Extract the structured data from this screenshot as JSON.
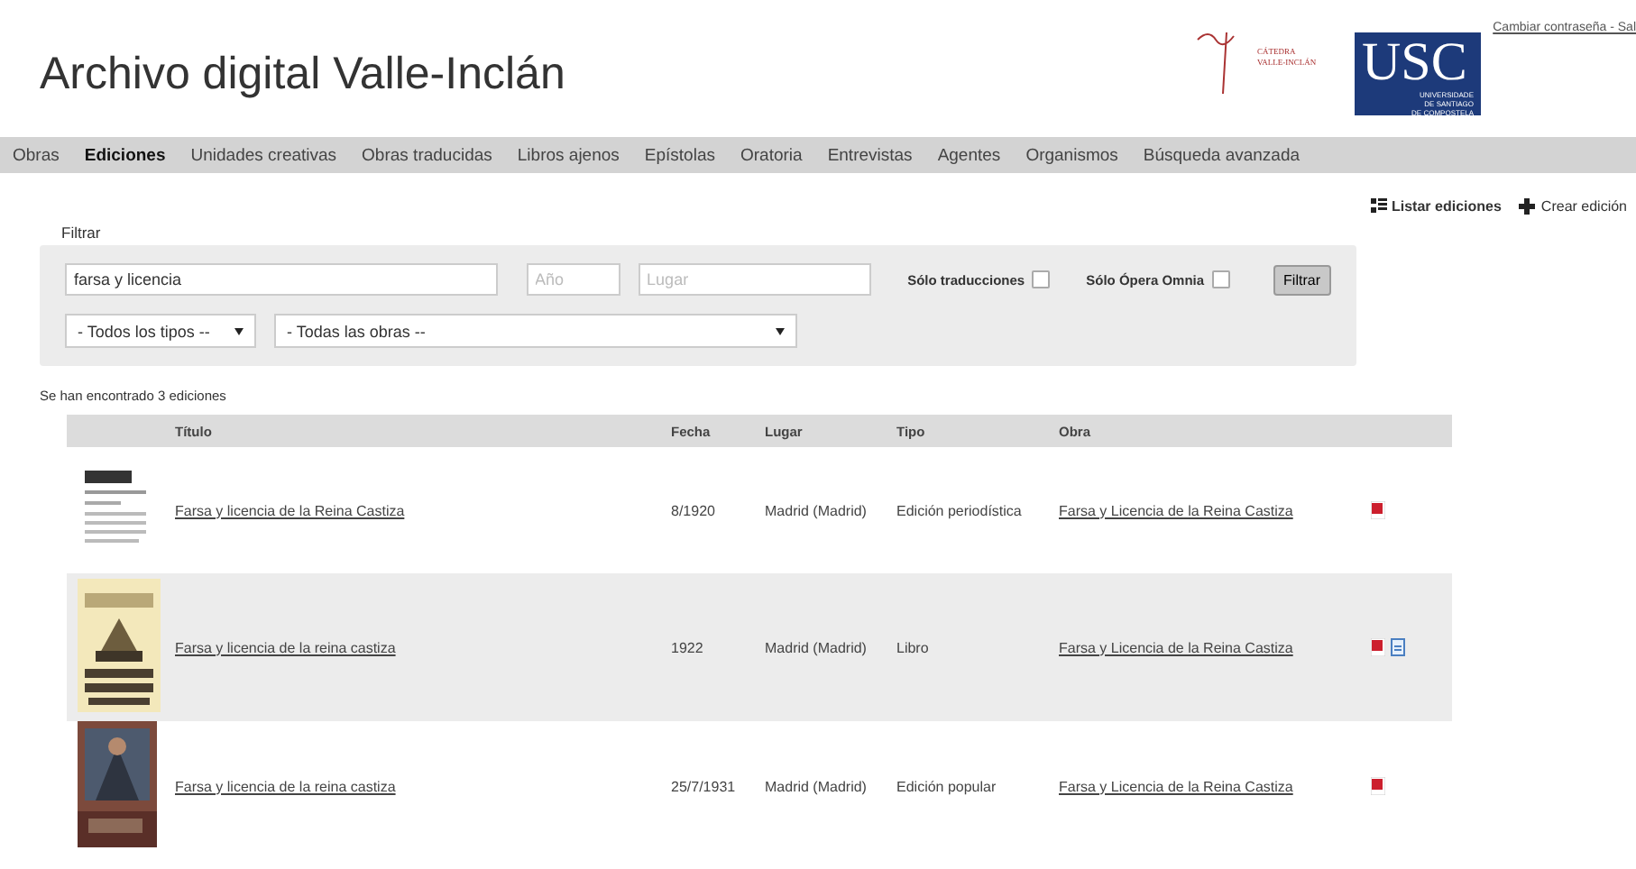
{
  "header": {
    "title": "Archivo digital Valle-Inclán",
    "catedra_logo": {
      "line1": "CÁTEDRA",
      "line2": "VALLE-INCLÁN"
    },
    "usc_logo": {
      "mark": "USC",
      "lines": [
        "UNIVERSIDADE",
        "DE SANTIAGO",
        "DE COMPOSTELA"
      ]
    },
    "user_links": "Cambiar contraseña - Sal"
  },
  "nav": [
    {
      "label": "Obras",
      "selected": false
    },
    {
      "label": "Ediciones",
      "selected": true
    },
    {
      "label": "Unidades creativas",
      "selected": false
    },
    {
      "label": "Obras traducidas",
      "selected": false
    },
    {
      "label": "Libros ajenos",
      "selected": false
    },
    {
      "label": "Epístolas",
      "selected": false
    },
    {
      "label": "Oratoria",
      "selected": false
    },
    {
      "label": "Entrevistas",
      "selected": false
    },
    {
      "label": "Agentes",
      "selected": false
    },
    {
      "label": "Organismos",
      "selected": false
    },
    {
      "label": "Búsqueda avanzada",
      "selected": false
    }
  ],
  "actions": [
    {
      "kind": "list",
      "label": "Listar ediciones"
    },
    {
      "kind": "create",
      "label": "Crear edición"
    }
  ],
  "filter": {
    "legend": "Filtrar",
    "search": {
      "value": "farsa y licencia"
    },
    "year": {
      "placeholder": "Año"
    },
    "place": {
      "placeholder": "Lugar"
    },
    "checks": [
      {
        "label": "Sólo traducciones",
        "checked": false
      },
      {
        "label": "Sólo Ópera Omnia",
        "checked": false
      }
    ],
    "button": "Filtrar",
    "type_select": "- Todos los tipos --",
    "work_select": "- Todas las obras --"
  },
  "result_count": "Se han encontrado 3 ediciones",
  "table": {
    "columns": [
      "Título",
      "Fecha",
      "Lugar",
      "Tipo",
      "Obra"
    ],
    "rows": [
      {
        "thumb": {
          "kind": "picture"
        },
        "title": "Farsa y licencia de la Reina Castiza",
        "date": "8/1920",
        "place": "Madrid (Madrid)",
        "type": "Edición periodística",
        "work": "Farsa y Licencia de la Reina Castiza",
        "files": [
          {
            "kind": "pdf"
          }
        ]
      },
      {
        "thumb": {
          "kind": "picture"
        },
        "title": "Farsa y licencia de la reina castiza",
        "date": "1922",
        "place": "Madrid (Madrid)",
        "type": "Libro",
        "work": "Farsa y Licencia de la Reina Castiza",
        "files": [
          {
            "kind": "pdf"
          },
          {
            "kind": "doc"
          }
        ]
      },
      {
        "thumb": {
          "kind": "picture"
        },
        "title": "Farsa y licencia de la reina castiza",
        "date": "25/7/1931",
        "place": "Madrid (Madrid)",
        "type": "Edición popular",
        "work": "Farsa y Licencia de la Reina Castiza",
        "files": [
          {
            "kind": "pdf"
          }
        ]
      }
    ]
  }
}
